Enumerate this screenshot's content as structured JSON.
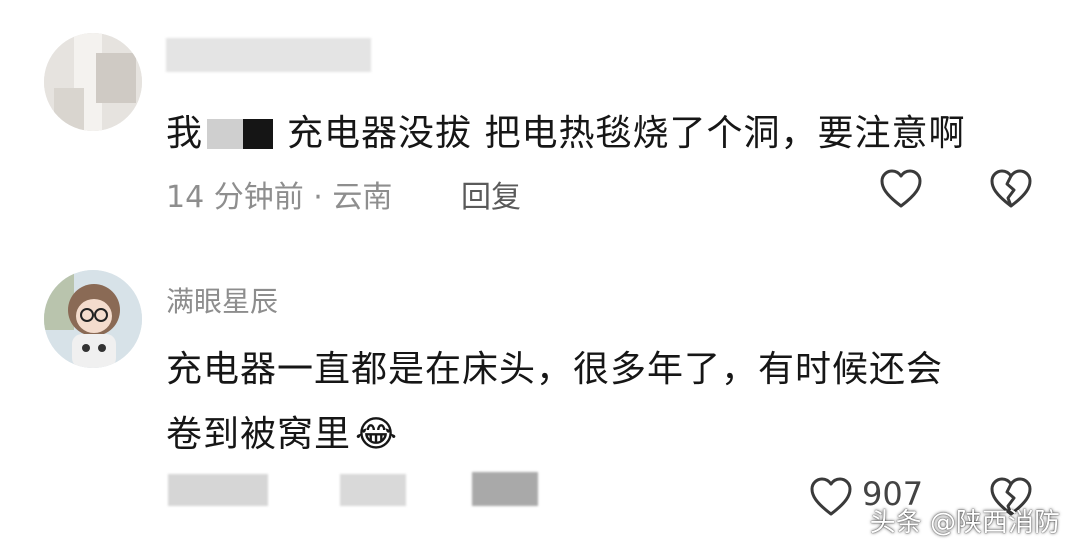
{
  "comments": [
    {
      "username": "",
      "text_before": "我",
      "text_after": "充电器没拔 把电热毯烧了个洞，要注意啊",
      "meta": "14 分钟前 · 云南",
      "reply_label": "回复",
      "like_icon": "heart-outline-icon",
      "dislike_icon": "broken-heart-icon"
    },
    {
      "username": "满眼星辰",
      "text_line1": "充电器一直都是在床头，很多年了，有时候还会",
      "text_line2": "卷到被窝里",
      "emoji": "😂",
      "like_count": "907",
      "like_icon": "heart-outline-icon",
      "dislike_icon": "broken-heart-icon"
    }
  ],
  "watermark": "头条 @陕西消防",
  "colors": {
    "text": "#161616",
    "meta": "#8e8e8e",
    "username": "#8d8d8d"
  }
}
